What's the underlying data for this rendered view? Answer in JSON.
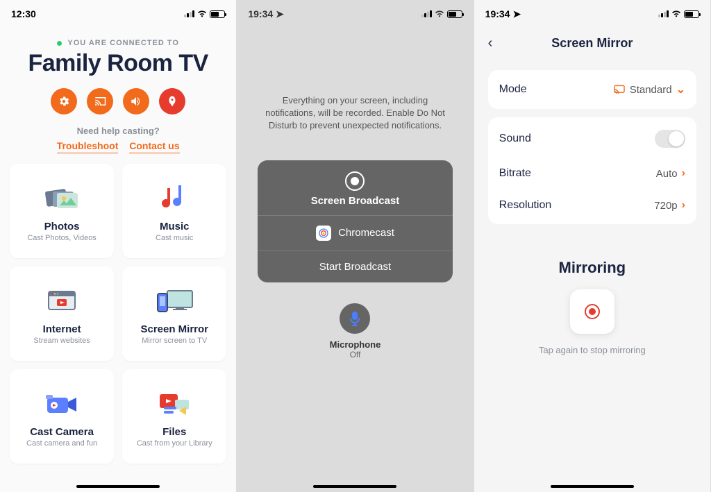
{
  "screen1": {
    "time": "12:30",
    "connected_label": "YOU ARE CONNECTED TO",
    "device_name": "Family Room TV",
    "help_question": "Need help casting?",
    "link_troubleshoot": "Troubleshoot",
    "link_contact": "Contact us",
    "tiles": [
      {
        "title": "Photos",
        "sub": "Cast Photos, Videos"
      },
      {
        "title": "Music",
        "sub": "Cast music"
      },
      {
        "title": "Internet",
        "sub": "Stream websites"
      },
      {
        "title": "Screen Mirror",
        "sub": "Mirror screen to TV"
      },
      {
        "title": "Cast Camera",
        "sub": "Cast camera and fun"
      },
      {
        "title": "Files",
        "sub": "Cast from your Library"
      }
    ]
  },
  "screen2": {
    "time": "19:34",
    "message": "Everything on your screen, including notifications, will be recorded. Enable Do Not Disturb to prevent unexpected notifications.",
    "sheet_title": "Screen Broadcast",
    "app_name": "Chromecast",
    "start_label": "Start Broadcast",
    "mic_label": "Microphone",
    "mic_status": "Off"
  },
  "screen3": {
    "time": "19:34",
    "title": "Screen Mirror",
    "mode_label": "Mode",
    "mode_value": "Standard",
    "sound_label": "Sound",
    "bitrate_label": "Bitrate",
    "bitrate_value": "Auto",
    "resolution_label": "Resolution",
    "resolution_value": "720p",
    "mirroring_title": "Mirroring",
    "mirroring_hint": "Tap again to stop mirroring"
  }
}
